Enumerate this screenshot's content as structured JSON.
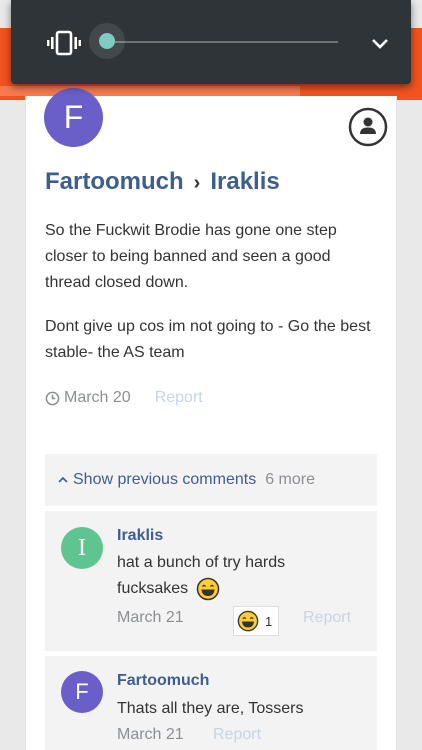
{
  "volume_panel": {
    "mode_icon": "vibrate-icon",
    "level": 0.0,
    "expand_icon": "chevron-down-icon"
  },
  "post": {
    "author_initial": "F",
    "author": "Fartoomuch",
    "recipient": "Iraklis",
    "separator": "›",
    "paragraphs": [
      "So the Fuckwit Brodie has gone one step closer to being banned and seen a good thread closed down.",
      "Dont give up cos im not going to - Go the best stable- the AS team"
    ],
    "date": "March 20",
    "report_label": "Report"
  },
  "comments_section": {
    "show_previous_label": "Show previous comments",
    "more_count": "6 more"
  },
  "comments": [
    {
      "initial": "I",
      "author": "Iraklis",
      "text": "hat a bunch of try hards fucksakes",
      "emoji": "laughing-emoji-icon",
      "date": "March 21",
      "reaction_count": "1",
      "report_label": "Report",
      "avatar_color": "#5ec590"
    },
    {
      "initial": "F",
      "author": "Fartoomuch",
      "text": "Thats all they are, Tossers",
      "date": "March 21",
      "report_label": "Report",
      "avatar_color": "#6a5ec8"
    }
  ],
  "colors": {
    "brand_orange": "#f2531f",
    "link_blue": "#3d5e8e",
    "panel_dark": "#2e3438",
    "slider_accent": "#80cbc4"
  }
}
